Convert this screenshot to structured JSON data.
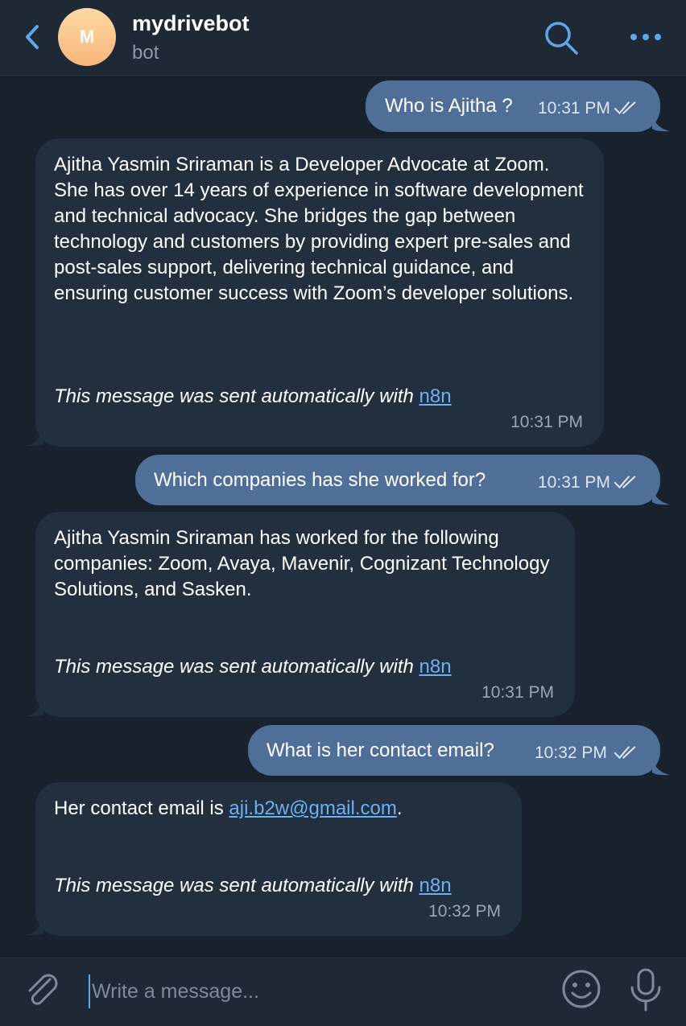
{
  "header": {
    "avatar_letter": "M",
    "title": "mydrivebot",
    "subtitle": "bot"
  },
  "messages": [
    {
      "side": "out",
      "text": "Who is Ajitha ?",
      "time": "10:31 PM"
    },
    {
      "side": "in",
      "text": "Ajitha Yasmin Sriraman is a Developer Advocate at Zoom. She has over 14 years of experience in software development and technical advocacy. She bridges the gap between technology and customers by providing expert pre-sales and post-sales support, delivering technical guidance, and ensuring customer success with Zoom’s developer solutions.",
      "auto_text": "This message was sent automatically with",
      "auto_link": "n8n",
      "time": "10:31 PM"
    },
    {
      "side": "out",
      "text": "Which companies has she worked for?",
      "time": "10:31 PM"
    },
    {
      "side": "in",
      "text": "Ajitha Yasmin Sriraman has worked for the following companies: Zoom, Avaya, Mavenir, Cognizant Technology Solutions, and Sasken.",
      "auto_text": "This message was sent automatically with",
      "auto_link": "n8n",
      "time": "10:31 PM"
    },
    {
      "side": "out",
      "text": "What is her contact email?",
      "time": "10:32 PM"
    },
    {
      "side": "in",
      "text_before": "Her contact email is",
      "email": "aji.b2w@gmail.com",
      "text_after": ".",
      "auto_text": "This message was sent automatically with",
      "auto_link": "n8n",
      "time": "10:32 PM"
    }
  ],
  "composer": {
    "placeholder": "Write a message..."
  },
  "colors": {
    "background": "#18222d",
    "header": "#1f2936",
    "outgoing_bubble": "#4f6f98",
    "incoming_bubble": "#222f3f",
    "accent": "#5ea5ea",
    "link": "#6ab0f3"
  },
  "icons": [
    "chevron-left-icon",
    "search-icon",
    "more-icon",
    "double-check-icon",
    "paperclip-icon",
    "emoji-icon",
    "microphone-icon"
  ]
}
